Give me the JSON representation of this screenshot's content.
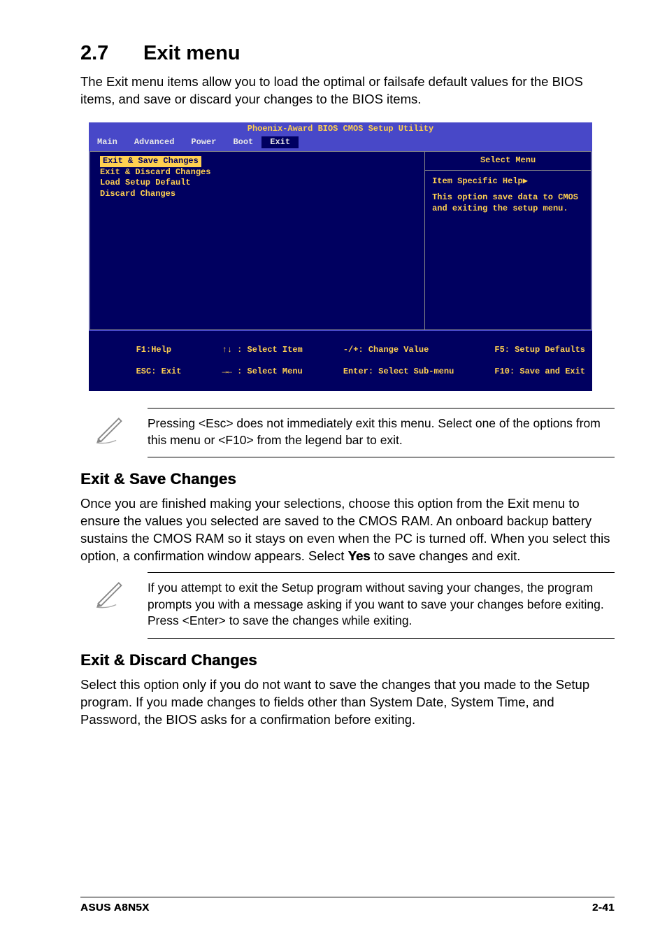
{
  "heading_num": "2.7",
  "heading_title": "Exit menu",
  "intro": "The Exit menu items allow you to load the optimal or failsafe default values for the BIOS items, and save or discard your changes to the BIOS items.",
  "bios": {
    "title": "Phoenix-Award BIOS CMOS Setup Utility",
    "tabs": [
      "Main",
      "Advanced",
      "Power",
      "Boot",
      "Exit"
    ],
    "active_tab": "Exit",
    "left_selected": "Exit & Save Changes",
    "left_items": [
      "Exit & Discard Changes",
      "Load Setup Default",
      "Discard Changes"
    ],
    "right_title": "Select Menu",
    "right_help_label": "Item Specific Help",
    "right_help_body": "This option save data to CMOS and exiting the setup menu.",
    "footer": {
      "f1": "F1:Help",
      "esc": "ESC: Exit",
      "sel_item": ": Select Item",
      "sel_menu": ": Select Menu",
      "chg": "-/+: Change Value",
      "enter": "Enter: Select Sub-menu",
      "f5": "F5: Setup Defaults",
      "f10": "F10: Save and Exit"
    }
  },
  "note1": "Pressing <Esc> does not immediately exit this menu. Select one of the options from this menu or <F10> from the legend bar to exit.",
  "h_save": "Exit & Save Changes",
  "p_save_a": "Once you are finished making your selections, choose this option from the Exit menu to ensure the values you selected are saved to the CMOS RAM. An onboard backup battery sustains the CMOS RAM so it stays on even when the PC is turned off. When you select this option, a confirmation window appears. Select ",
  "p_save_yes": "Yes",
  "p_save_b": " to save changes and exit.",
  "note2": " If you attempt to exit the Setup program without saving your changes, the program prompts you with a message asking if you want to save your changes before exiting. Press <Enter>  to save the  changes while exiting.",
  "h_discard": "Exit & Discard Changes",
  "p_discard": "Select this option only if you do not want to save the changes that you made to the Setup program. If you made changes to fields other than System Date, System Time, and Password, the BIOS asks for a confirmation before exiting.",
  "footer_left": "ASUS A8N5X",
  "footer_right": "2-41"
}
